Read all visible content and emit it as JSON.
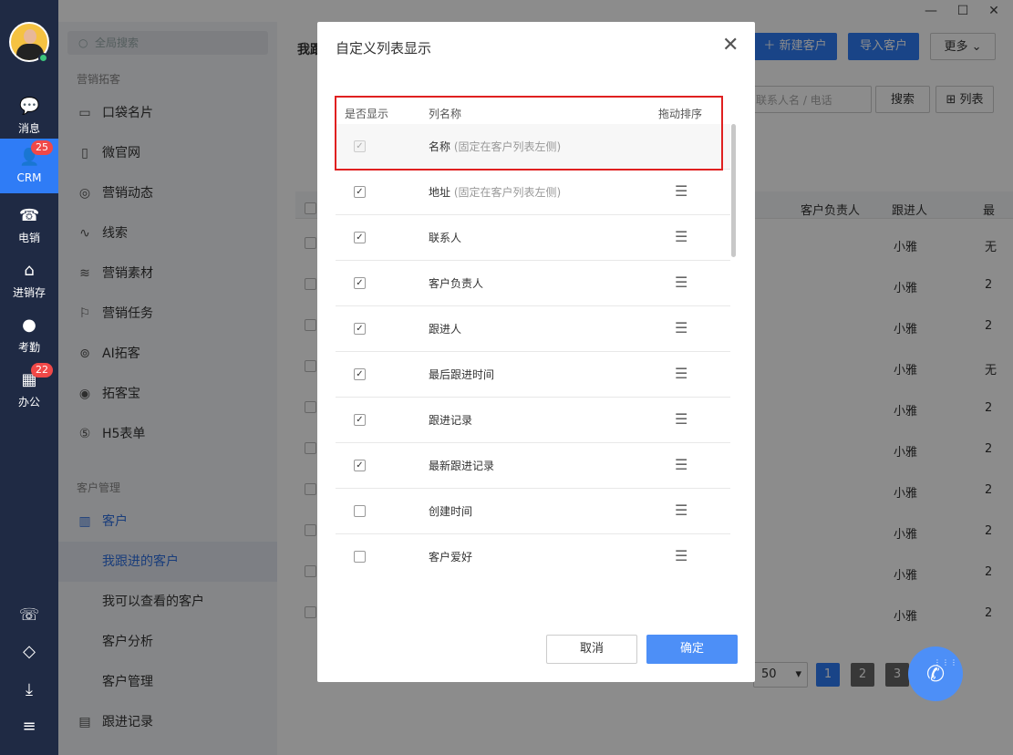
{
  "rail": {
    "items": [
      {
        "label": "消息",
        "icon": "chat-bubble-icon"
      },
      {
        "label": "CRM",
        "icon": "person-icon",
        "badge": "25"
      },
      {
        "label": "电销",
        "icon": "phone-icon"
      },
      {
        "label": "进销存",
        "icon": "warehouse-icon"
      },
      {
        "label": "考勤",
        "icon": "location-pin-icon"
      },
      {
        "label": "办公",
        "icon": "apps-icon",
        "badge": "22"
      }
    ]
  },
  "window": {
    "minimize": "—",
    "maximize": "☐",
    "close": "✕"
  },
  "sidebar": {
    "search_placeholder": "全局搜索",
    "section1": "营销拓客",
    "marketing_items": [
      "口袋名片",
      "微官网",
      "营销动态",
      "线索",
      "营销素材",
      "营销任务",
      "AI拓客",
      "拓客宝",
      "H5表单"
    ],
    "section2": "客户管理",
    "customer_label": "客户",
    "customer_sub": [
      "我跟进的客户",
      "我可以查看的客户",
      "客户分析",
      "客户管理"
    ],
    "followup_label": "跟进记录"
  },
  "main": {
    "title_partial": "我跟",
    "new_customer": "新建客户",
    "import_customer": "导入客户",
    "more": "更多",
    "search_placeholder": "联系人名 / 电话",
    "search_button": "搜索",
    "list_button": "列表",
    "col_owner": "客户负责人",
    "col_follower": "跟进人",
    "col_last": "最",
    "follower_values": [
      "小雅",
      "小雅",
      "小雅",
      "小雅",
      "小雅",
      "小雅",
      "小雅",
      "小雅",
      "小雅",
      "小雅"
    ],
    "last_values": [
      "无",
      "2",
      "2",
      "无",
      "2",
      "2",
      "2",
      "2",
      "2",
      "2"
    ],
    "page_size": "50",
    "pages": [
      "1",
      "2",
      "3"
    ]
  },
  "modal": {
    "title": "自定义列表显示",
    "header": {
      "show": "是否显示",
      "name": "列名称",
      "sort": "拖动排序"
    },
    "rows": [
      {
        "name": "名称",
        "note": "(固定在客户列表左侧)",
        "checked": true,
        "disabled": true
      },
      {
        "name": "地址",
        "note": "(固定在客户列表左侧)",
        "checked": true,
        "disabled": false
      },
      {
        "name": "联系人",
        "note": "",
        "checked": true,
        "disabled": false
      },
      {
        "name": "客户负责人",
        "note": "",
        "checked": true,
        "disabled": false
      },
      {
        "name": "跟进人",
        "note": "",
        "checked": true,
        "disabled": false
      },
      {
        "name": "最后跟进时间",
        "note": "",
        "checked": true,
        "disabled": false
      },
      {
        "name": "跟进记录",
        "note": "",
        "checked": true,
        "disabled": false
      },
      {
        "name": "最新跟进记录",
        "note": "",
        "checked": true,
        "disabled": false
      },
      {
        "name": "创建时间",
        "note": "",
        "checked": false,
        "disabled": false
      },
      {
        "name": "客户爱好",
        "note": "",
        "checked": false,
        "disabled": false
      }
    ],
    "cancel": "取消",
    "confirm": "确定"
  }
}
